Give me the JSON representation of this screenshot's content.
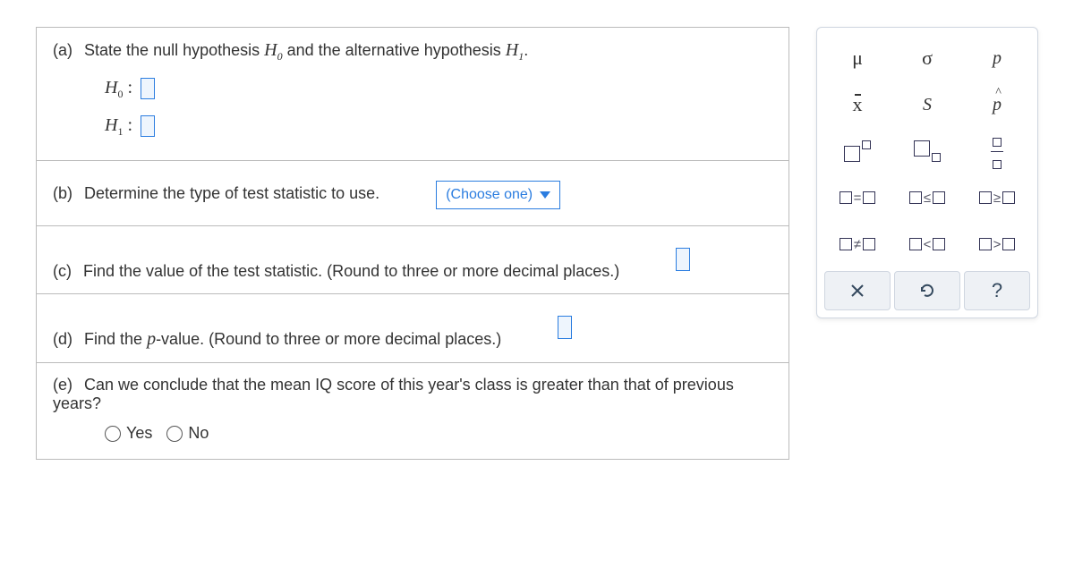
{
  "parts": {
    "a": {
      "letter": "(a)",
      "prompt_prefix": "State the null hypothesis ",
      "prompt_mid": " and the alternative hypothesis ",
      "prompt_suffix": ".",
      "h0_sym": "H",
      "h0_sub": "0",
      "h1_sym": "H",
      "h1_sub": "1",
      "colon": " :"
    },
    "b": {
      "letter": "(b)",
      "prompt": "Determine the type of test statistic to use.",
      "select_label": "(Choose one)"
    },
    "c": {
      "letter": "(c)",
      "prompt": "Find the value of the test statistic. (Round to three or more decimal places.)"
    },
    "d": {
      "letter": "(d)",
      "prompt_prefix": "Find the ",
      "prompt_ital": "p",
      "prompt_suffix": "-value. (Round to three or more decimal places.)"
    },
    "e": {
      "letter": "(e)",
      "prompt": "Can we conclude that the mean IQ score of this year's class is greater than that of previous years?",
      "yes": "Yes",
      "no": "No"
    }
  },
  "palette": {
    "mu": "μ",
    "sigma": "σ",
    "p": "p",
    "xbar": "x",
    "s": "S",
    "phat": "p",
    "eq": "=",
    "le": "≤",
    "ge": "≥",
    "ne": "≠",
    "lt": "<",
    "gt": ">",
    "help": "?"
  }
}
